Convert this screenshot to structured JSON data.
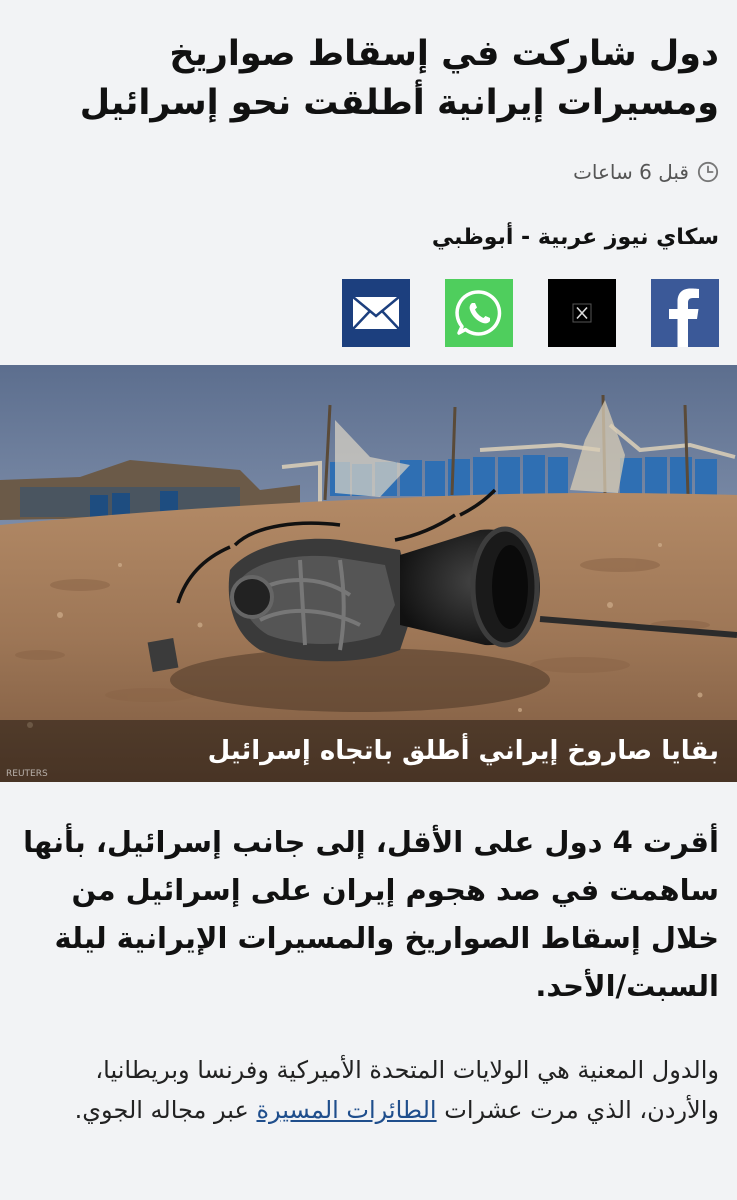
{
  "article": {
    "headline": "دول شاركت في إسقاط صواريخ ومسيرات إيرانية أطلقت نحو إسرائيل",
    "time_ago": "قبل 6 ساعات",
    "source": "سكاي نيوز عربية - أبوظبي"
  },
  "share": {
    "buttons": [
      {
        "name": "facebook",
        "icon": "facebook-icon",
        "color": "#3b5998"
      },
      {
        "name": "x",
        "icon": "x-icon",
        "color": "#000000"
      },
      {
        "name": "whatsapp",
        "icon": "whatsapp-icon",
        "color": "#4fce5d"
      },
      {
        "name": "email",
        "icon": "envelope-icon",
        "color": "#1c3f7e"
      }
    ]
  },
  "image": {
    "caption": "بقايا صاروخ إيراني أطلق باتجاه إسرائيل",
    "credit": "REUTERS"
  },
  "lead": "أقرت 4 دول على الأقل، إلى جانب إسرائيل، بأنها ساهمت في صد هجوم إيران على إسرائيل من خلال إسقاط الصواريخ والمسيرات الإيرانية ليلة السبت/الأحد.",
  "body": {
    "before_link": "والدول المعنية هي الولايات المتحدة الأميركية وفرنسا وبريطانيا، والأردن، الذي مرت عشرات ",
    "link_text": "الطائرات المسيرة",
    "after_link": " عبر مجاله الجوي."
  },
  "colors": {
    "background": "#f2f3f5",
    "link": "#1f4e8c"
  }
}
